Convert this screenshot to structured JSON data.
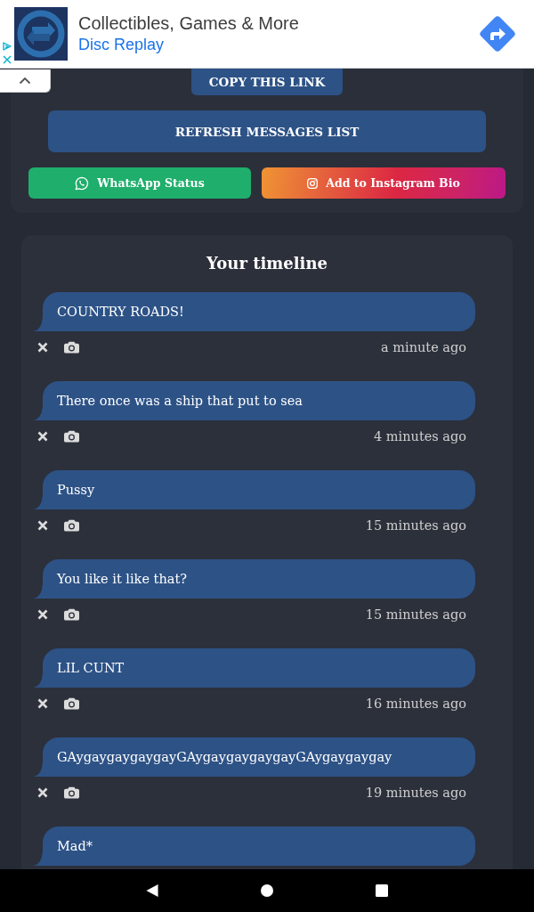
{
  "ad_banner": {
    "headline": "Collectibles, Games & More",
    "advertiser": "Disc Replay"
  },
  "share_panel": {
    "copy_button": "COPY THIS LINK",
    "refresh_button": "REFRESH MESSAGES LIST",
    "share_buttons": [
      {
        "kind": "whatsapp",
        "label": "WhatsApp Status"
      },
      {
        "kind": "instagram",
        "label": "Add to Instagram Bio"
      }
    ]
  },
  "timeline": {
    "title": "Your timeline",
    "messages": [
      {
        "text": "COUNTRY ROADS!",
        "time": "a minute ago"
      },
      {
        "text": "There once was a ship that put to sea",
        "time": "4 minutes ago"
      },
      {
        "text": "Pussy",
        "time": "15 minutes ago"
      },
      {
        "text": "You like it like that?",
        "time": "15 minutes ago"
      },
      {
        "text": "LIL CUNT",
        "time": "16 minutes ago"
      },
      {
        "text": "GAygaygaygaygayGAygaygaygaygayGAygaygaygay",
        "time": "19 minutes ago"
      },
      {
        "text": "Mad*"
      }
    ]
  }
}
